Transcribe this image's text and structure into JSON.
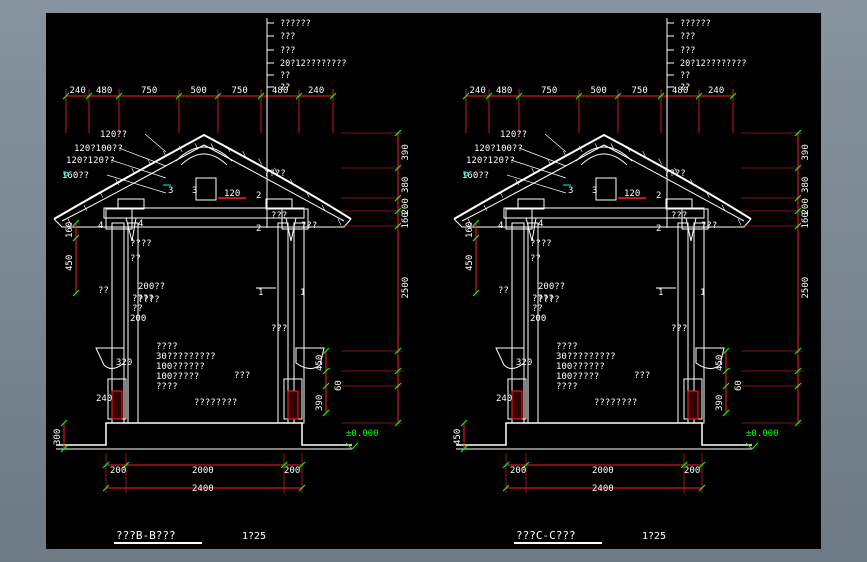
{
  "drawing": {
    "left": {
      "title": "???B-B???",
      "scale": "1?25",
      "top_dims": [
        "240",
        "480",
        "750",
        "500",
        "750",
        "480",
        "240"
      ],
      "notes_top": [
        "??????",
        "???",
        "???",
        "20?12????????",
        "??",
        "??"
      ],
      "left_notes": [
        "120??",
        "120?100??",
        "120?120??",
        "160??"
      ],
      "small_notes": [
        "????",
        "????",
        "??",
        "???",
        "???",
        "????",
        "???",
        "??"
      ],
      "labels_mid": [
        "200??",
        "????"
      ],
      "labels_base": [
        "????",
        "30?????????",
        "100??????",
        "100?????",
        "????"
      ],
      "label_anchor": "??",
      "label_fill": "????????",
      "label_bar": "???",
      "right_dims": [
        "390",
        "380",
        "200",
        "160",
        "2500",
        "450",
        "60",
        "390"
      ],
      "left_dims": [
        "160",
        "450",
        "200",
        "320",
        "240",
        "300"
      ],
      "bottom_dims": [
        "200",
        "2000",
        "200",
        "2400"
      ],
      "level": "±0.000",
      "nums": [
        "4",
        "4",
        "3",
        "3",
        "2",
        "2",
        "1",
        "1",
        "120"
      ]
    },
    "right": {
      "title": "???C-C???",
      "scale": "1?25",
      "top_dims": [
        "240",
        "480",
        "750",
        "500",
        "750",
        "480",
        "240"
      ],
      "notes_top": [
        "??????",
        "???",
        "???",
        "20?12????????",
        "??",
        "??"
      ],
      "left_notes": [
        "120??",
        "120?100??",
        "120?120??",
        "160??"
      ],
      "small_notes": [
        "????",
        "????",
        "??",
        "???",
        "???",
        "????",
        "???",
        "??"
      ],
      "labels_mid": [
        "200??",
        "????"
      ],
      "labels_base": [
        "????",
        "30?????????",
        "100??????",
        "100?????",
        "????"
      ],
      "label_anchor": "??",
      "label_fill": "????????",
      "label_bar": "???",
      "right_dims": [
        "390",
        "380",
        "200",
        "160",
        "2500",
        "450",
        "60",
        "390"
      ],
      "left_dims": [
        "160",
        "450",
        "200",
        "320",
        "240",
        "450"
      ],
      "bottom_dims": [
        "200",
        "2000",
        "200",
        "2400"
      ],
      "level": "±0.000",
      "nums": [
        "4",
        "4",
        "3",
        "3",
        "2",
        "2",
        "1",
        "1",
        "120"
      ]
    }
  },
  "colors": {
    "background": "#000000",
    "frame": "#7a8793",
    "lines": "#ffffff",
    "dims": "#ff2020",
    "ext": "#00ff00",
    "accent": "#00ffff",
    "level": "#00ff00"
  }
}
